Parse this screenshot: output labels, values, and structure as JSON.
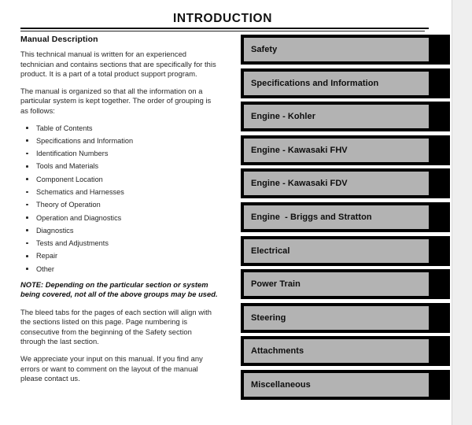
{
  "document": {
    "title": "INTRODUCTION"
  },
  "left_column": {
    "heading": "Manual Description",
    "intro_paragraphs": [
      "This technical manual is written for an experienced technician and contains sections that are specifically for this product. It is a part of a total product support program.",
      "The manual is organized so that all the information on a particular system is kept together. The order of grouping is as follows:"
    ],
    "group_list": [
      "Table of Contents",
      "Specifications and Information",
      "Identification Numbers",
      "Tools and Materials",
      "Component Location",
      "Schematics and Harnesses",
      "Theory of Operation",
      "Operation and Diagnostics",
      "Diagnostics",
      "Tests and Adjustments",
      "Repair",
      "Other"
    ],
    "note": "NOTE: Depending on the particular section or system being covered, not all of the above groups may be used.",
    "closing_paragraphs": [
      "The bleed tabs for the pages of each section will align with the sections listed on this page. Page numbering is consecutive from the beginning of the Safety section through the last section.",
      "We appreciate your input on this manual. If you find any errors or want to comment on the layout of the manual please contact us."
    ]
  },
  "bleed_tabs": {
    "items": [
      {
        "label": "Safety"
      },
      {
        "label": "Specifications and Information"
      },
      {
        "label": "Engine - Kohler"
      },
      {
        "label": "Engine - Kawasaki FHV"
      },
      {
        "label": "Engine - Kawasaki FDV"
      },
      {
        "label": "Engine  - Briggs and Stratton"
      },
      {
        "label": "Electrical"
      },
      {
        "label": "Power Train"
      },
      {
        "label": "Steering"
      },
      {
        "label": "Attachments"
      },
      {
        "label": "Miscellaneous"
      }
    ]
  },
  "colors": {
    "page_background": "#ffffff",
    "gutter_background": "#efefef",
    "tab_frame": "#000000",
    "tab_face": "#b3b3b3",
    "text": "#1c1c1c"
  }
}
